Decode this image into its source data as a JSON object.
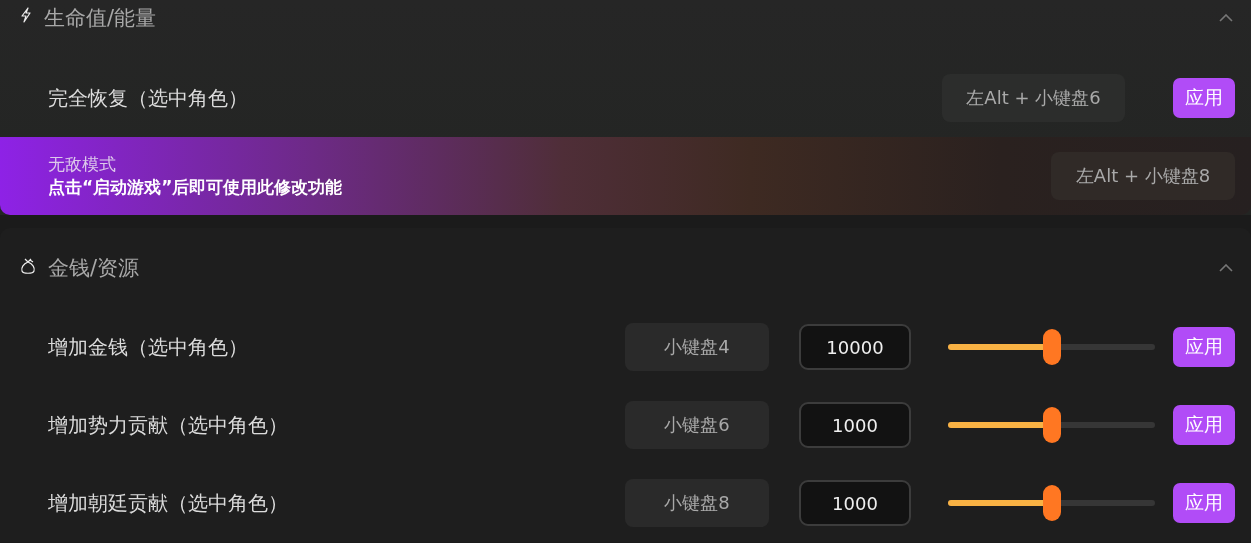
{
  "sections": [
    {
      "title": "生命值/能量",
      "expanded": true,
      "items": [
        {
          "kind": "apply",
          "label": "完全恢复（选中角色）",
          "hotkey": "左Alt + 小键盘6",
          "button": "应用"
        },
        {
          "kind": "locked",
          "label": "无敌模式",
          "notice": "点击“启动游戏”后即可使用此修改功能",
          "hotkey": "左Alt + 小键盘8"
        }
      ]
    },
    {
      "title": "金钱/资源",
      "expanded": true,
      "items": [
        {
          "kind": "value",
          "label": "增加金钱（选中角色）",
          "hotkey": "小键盘4",
          "value": "10000",
          "level": 0.5,
          "button": "应用"
        },
        {
          "kind": "value",
          "label": "增加势力贡献（选中角色）",
          "hotkey": "小键盘6",
          "value": "1000",
          "level": 0.5,
          "button": "应用"
        },
        {
          "kind": "value",
          "label": "增加朝廷贡献（选中角色）",
          "hotkey": "小键盘8",
          "value": "1000",
          "level": 0.5,
          "button": "应用"
        }
      ]
    }
  ]
}
